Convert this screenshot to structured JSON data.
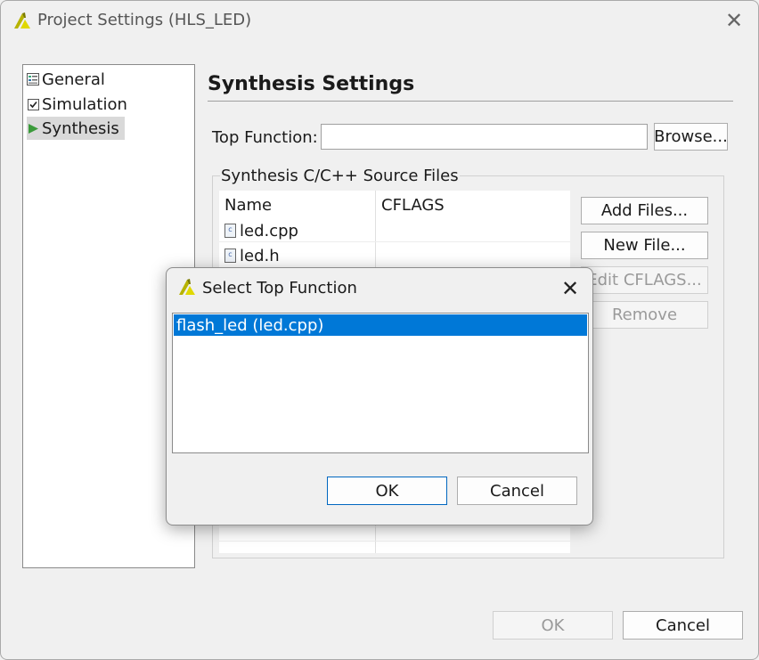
{
  "window": {
    "title": "Project Settings (HLS_LED)"
  },
  "tree": {
    "items": [
      {
        "label": "General",
        "icon": "general-icon"
      },
      {
        "label": "Simulation",
        "icon": "checkbox-icon"
      },
      {
        "label": "Synthesis",
        "icon": "play-arrow-icon"
      }
    ],
    "selected": "Synthesis"
  },
  "synthesis": {
    "title": "Synthesis Settings",
    "top_function_label": "Top Function:",
    "top_function_value": "",
    "browse_label": "Browse...",
    "group_title": "Synthesis C/C++ Source Files",
    "columns": [
      "Name",
      "CFLAGS"
    ],
    "files": [
      {
        "name": "led.cpp",
        "cflags": ""
      },
      {
        "name": "led.h",
        "cflags": ""
      }
    ],
    "buttons": {
      "add_files": "Add Files...",
      "new_file": "New File...",
      "edit_cflags": "Edit CFLAGS...",
      "remove": "Remove"
    }
  },
  "footer": {
    "ok": "OK",
    "cancel": "Cancel"
  },
  "dialog": {
    "title": "Select Top Function",
    "items": [
      "flash_led (led.cpp)"
    ],
    "ok": "OK",
    "cancel": "Cancel"
  },
  "colors": {
    "selection": "#0078d7",
    "logo": "#c8c400"
  }
}
